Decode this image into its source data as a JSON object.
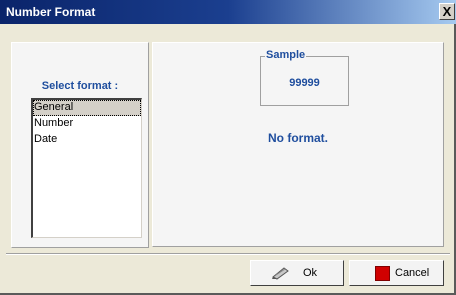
{
  "window": {
    "title": "Number Format",
    "close_label": "X"
  },
  "left_panel": {
    "label": "Select format :",
    "items": [
      "General",
      "Number",
      "Date"
    ],
    "selected_index": 0
  },
  "right_panel": {
    "sample_title": "Sample",
    "sample_value": "99999",
    "status": "No format."
  },
  "buttons": {
    "ok_label": "Ok",
    "cancel_label": "Cancel"
  },
  "icons": {
    "ok": "pen-icon",
    "cancel": "red-square-icon",
    "close": "close-icon"
  },
  "colors": {
    "accent_text": "#1f4e9e",
    "titlebar": "#0a246a",
    "cancel_icon": "#d00000"
  }
}
